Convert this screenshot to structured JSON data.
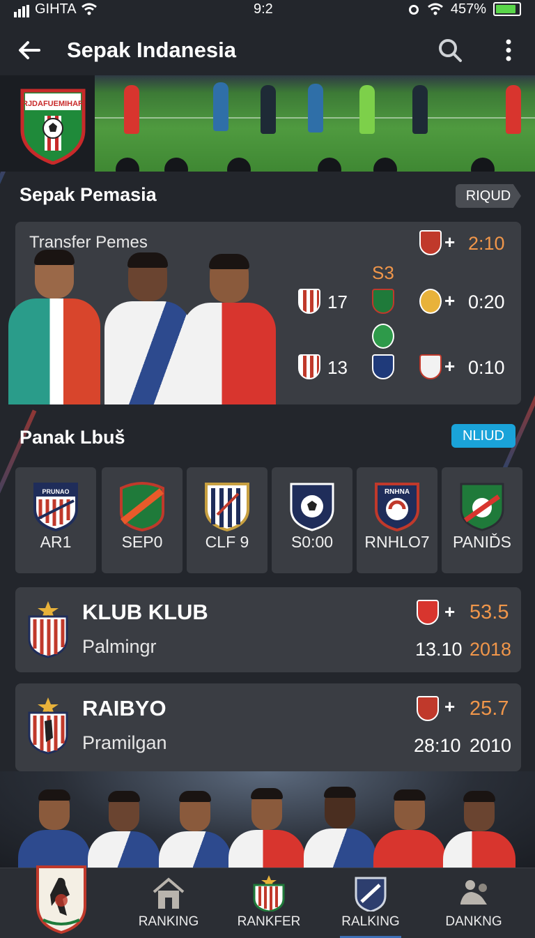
{
  "status_bar": {
    "carrier": "GIHTA",
    "time": "9:2",
    "battery": "457%"
  },
  "header": {
    "title": "Sepak Indanesia"
  },
  "section1": {
    "title": "Sepak Pemasia",
    "badge": "RIQUD",
    "card_label": "Transfer Pemes",
    "center_label": "S3",
    "rows": [
      {
        "number": "",
        "plus": "+",
        "score": "2:10"
      },
      {
        "number": "17",
        "plus": "+",
        "score": "0:20"
      },
      {
        "number": "13",
        "plus": "+",
        "score": "0:10"
      }
    ]
  },
  "section2": {
    "title": "Panak Lbuš",
    "badge": "NLIUD",
    "tiles": [
      {
        "label": "AR1",
        "crest_text": "PRUNAO"
      },
      {
        "label": "SEP0",
        "crest_text": ""
      },
      {
        "label": "CLF 9",
        "crest_text": ""
      },
      {
        "label": "S0:00",
        "crest_text": ""
      },
      {
        "label": "RNHLO7",
        "crest_text": "RNHNA"
      },
      {
        "label": "PANIĎS",
        "crest_text": ""
      }
    ]
  },
  "clubs": [
    {
      "name": "KLUB KLUB",
      "sub": "Palmingr",
      "plus": "+",
      "score": "53.5",
      "date_a": "13.10",
      "date_b": "2018"
    },
    {
      "name": "RAIBYO",
      "sub": "Pramilgan",
      "plus": "+",
      "score": "25.7",
      "date_a": "28:10",
      "date_b": "2010"
    }
  ],
  "hero_crest_text": "RJDAFUEMIHAR",
  "bottom_nav": [
    {
      "label": "RANKING"
    },
    {
      "label": "RANKFER"
    },
    {
      "label": "RALKING"
    },
    {
      "label": "DANKNG"
    }
  ],
  "colors": {
    "accent_orange": "#f0964a",
    "accent_blue": "#1aa3d9",
    "card_bg": "#3a3d43",
    "page_bg": "#23262c"
  }
}
